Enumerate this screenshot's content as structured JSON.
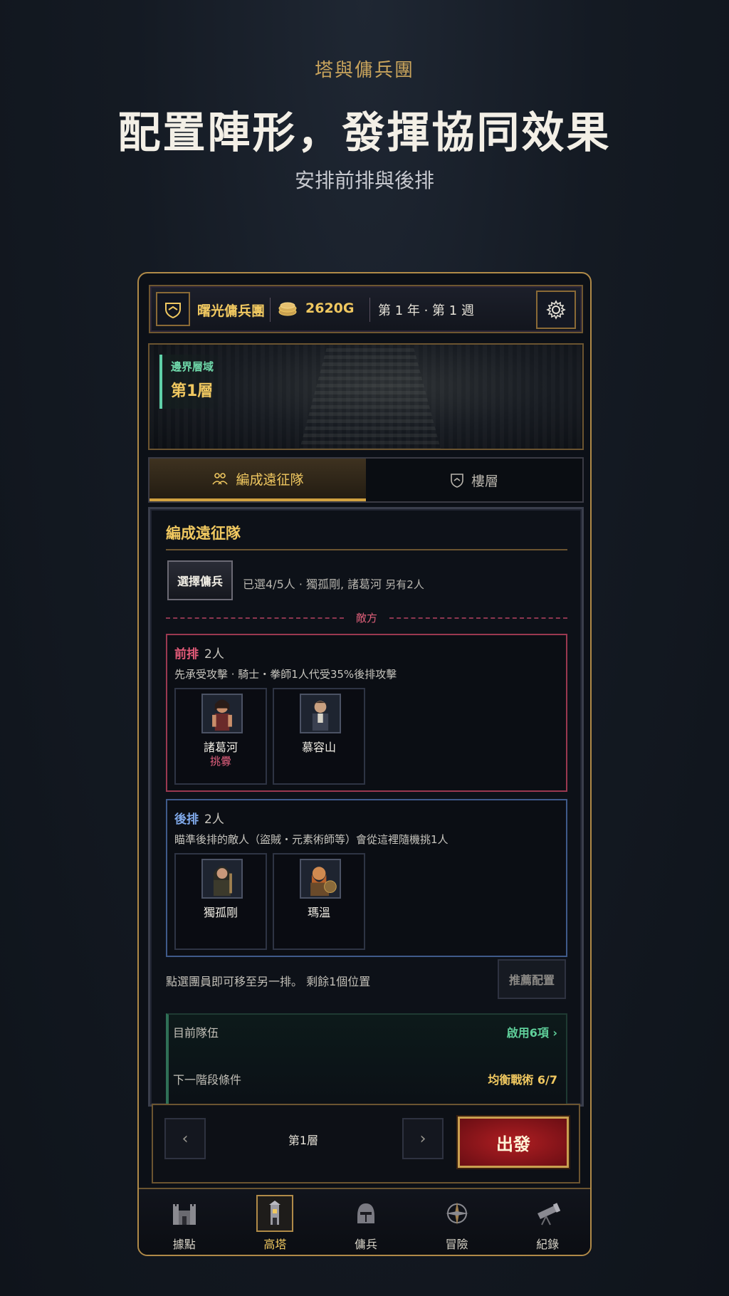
{
  "hero": {
    "kicker": "塔與傭兵團",
    "headline": "配置陣形，發揮協同效果",
    "subline": "安排前排與後排"
  },
  "topbar": {
    "guild_name": "曙光傭兵團",
    "gold": "2620G",
    "date": "第 1 年 · 第 1 週"
  },
  "banner": {
    "region": "邊界層域",
    "floor": "第1層"
  },
  "tabs": [
    {
      "label": "編成遠征隊",
      "active": true
    },
    {
      "label": "樓層",
      "active": false
    }
  ],
  "panel": {
    "title": "編成遠征隊",
    "pick_button": "選擇傭兵",
    "selection_info": "已選4/5人 · 獨孤剛, 諸葛河",
    "selection_more": "另有2人",
    "enemy_label": "敵方",
    "front": {
      "name": "前排",
      "count": "2人",
      "desc": "先承受攻擊 · 騎士・拳師1人代受35%後排攻擊",
      "members": [
        {
          "name": "諸葛河",
          "tag": "挑釁"
        },
        {
          "name": "慕容山",
          "tag": ""
        }
      ]
    },
    "back": {
      "name": "後排",
      "count": "2人",
      "desc": "瞄準後排的敵人（盜賊・元素術師等）會從這裡隨機挑1人",
      "members": [
        {
          "name": "獨孤剛",
          "tag": ""
        },
        {
          "name": "瑪溫",
          "tag": ""
        }
      ]
    },
    "move_hint": "點選團員即可移至另一排。 剩餘1個位置",
    "recommend_button": "推薦配置",
    "team_label": "目前隊伍",
    "team_value": "啟用6項 ›",
    "next_label": "下一階段條件",
    "next_value": "均衡戰術 6/7"
  },
  "floor_nav": {
    "prev": "‹",
    "next": "›",
    "floor_name": "第1層",
    "depart_button": "出發"
  },
  "bottom_nav": [
    {
      "label": "據點",
      "icon": "castle-icon",
      "active": false
    },
    {
      "label": "高塔",
      "icon": "tower-icon",
      "active": true
    },
    {
      "label": "傭兵",
      "icon": "helmet-icon",
      "active": false
    },
    {
      "label": "冒險",
      "icon": "compass-icon",
      "active": false
    },
    {
      "label": "紀錄",
      "icon": "telescope-icon",
      "active": false
    }
  ],
  "colors": {
    "gold_accent": "#f0c860",
    "front_row": "#9a3850",
    "back_row": "#3f5a8a",
    "depart_red": "#b01e22"
  }
}
